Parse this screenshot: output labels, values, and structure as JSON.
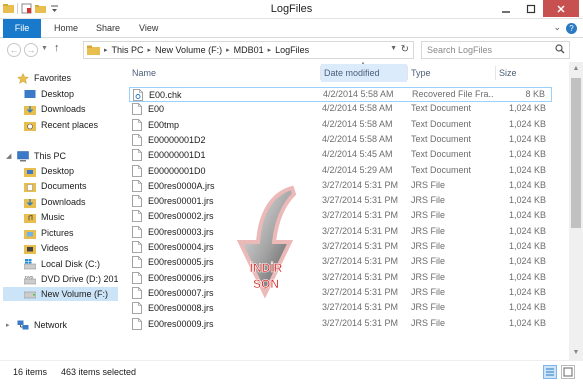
{
  "window": {
    "title": "LogFiles"
  },
  "ribbon": {
    "tabs": [
      "File",
      "Home",
      "Share",
      "View"
    ]
  },
  "address": {
    "crumbs": [
      "This PC",
      "New Volume (F:)",
      "MDB01",
      "LogFiles"
    ],
    "search_placeholder": "Search LogFiles"
  },
  "nav": {
    "favorites": {
      "label": "Favorites",
      "items": [
        "Desktop",
        "Downloads",
        "Recent places"
      ]
    },
    "thispc": {
      "label": "This PC",
      "items": [
        "Desktop",
        "Documents",
        "Downloads",
        "Music",
        "Pictures",
        "Videos",
        "Local Disk (C:)",
        "DVD Drive (D:) 20139",
        "New Volume (F:)"
      ]
    },
    "network": {
      "label": "Network"
    }
  },
  "columns": {
    "name": "Name",
    "date": "Date modified",
    "type": "Type",
    "size": "Size"
  },
  "files": [
    {
      "name": "E00.chk",
      "date": "4/2/2014 5:58 AM",
      "type": "Recovered File Fra...",
      "size": "8 KB"
    },
    {
      "name": "E00",
      "date": "4/2/2014 5:58 AM",
      "type": "Text Document",
      "size": "1,024 KB"
    },
    {
      "name": "E00tmp",
      "date": "4/2/2014 5:58 AM",
      "type": "Text Document",
      "size": "1,024 KB"
    },
    {
      "name": "E00000001D2",
      "date": "4/2/2014 5:58 AM",
      "type": "Text Document",
      "size": "1,024 KB"
    },
    {
      "name": "E00000001D1",
      "date": "4/2/2014 5:45 AM",
      "type": "Text Document",
      "size": "1,024 KB"
    },
    {
      "name": "E00000001D0",
      "date": "4/2/2014 5:29 AM",
      "type": "Text Document",
      "size": "1,024 KB"
    },
    {
      "name": "E00res0000A.jrs",
      "date": "3/27/2014 5:31 PM",
      "type": "JRS File",
      "size": "1,024 KB"
    },
    {
      "name": "E00res00001.jrs",
      "date": "3/27/2014 5:31 PM",
      "type": "JRS File",
      "size": "1,024 KB"
    },
    {
      "name": "E00res00002.jrs",
      "date": "3/27/2014 5:31 PM",
      "type": "JRS File",
      "size": "1,024 KB"
    },
    {
      "name": "E00res00003.jrs",
      "date": "3/27/2014 5:31 PM",
      "type": "JRS File",
      "size": "1,024 KB"
    },
    {
      "name": "E00res00004.jrs",
      "date": "3/27/2014 5:31 PM",
      "type": "JRS File",
      "size": "1,024 KB"
    },
    {
      "name": "E00res00005.jrs",
      "date": "3/27/2014 5:31 PM",
      "type": "JRS File",
      "size": "1,024 KB"
    },
    {
      "name": "E00res00006.jrs",
      "date": "3/27/2014 5:31 PM",
      "type": "JRS File",
      "size": "1,024 KB"
    },
    {
      "name": "E00res00007.jrs",
      "date": "3/27/2014 5:31 PM",
      "type": "JRS File",
      "size": "1,024 KB"
    },
    {
      "name": "E00res00008.jrs",
      "date": "3/27/2014 5:31 PM",
      "type": "JRS File",
      "size": "1,024 KB"
    },
    {
      "name": "E00res00009.jrs",
      "date": "3/27/2014 5:31 PM",
      "type": "JRS File",
      "size": "1,024 KB"
    }
  ],
  "status": {
    "count": "16 items",
    "selected": "463 items selected"
  },
  "watermark": {
    "line1": "İNDİR",
    "line2": "SON"
  },
  "colors": {
    "file_tab": "#1979ca",
    "selection": "#cce4f7",
    "close_button": "#c75050",
    "folder": "#e8bf4e",
    "watermark_red": "#d9302c"
  }
}
